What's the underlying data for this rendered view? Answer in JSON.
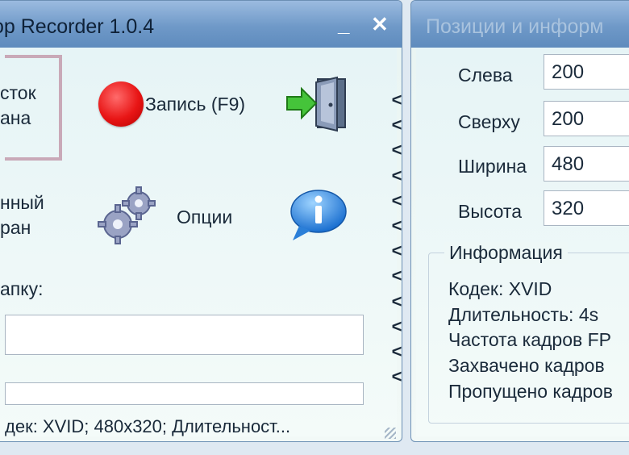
{
  "left_window": {
    "title": "op Recorder 1.0.4",
    "minimize_glyph": "_",
    "close_glyph": "✕",
    "region_button": {
      "line1": "сток",
      "line2": "ана"
    },
    "record_button": {
      "label": "Запись (F9)"
    },
    "exit_button": {
      "icon": "exit-door-icon"
    },
    "fullscreen_button": {
      "line1": "нный",
      "line2": "ран"
    },
    "options_button": {
      "label": "Опции"
    },
    "info_button": {
      "icon": "info-icon"
    },
    "folder_label": "апку:",
    "folder_input_value": "",
    "second_input_value": "",
    "collapse_chevrons": [
      "<",
      "<",
      "<",
      "<",
      "<",
      "<",
      "<",
      "<",
      "<",
      "<",
      "<",
      "<"
    ],
    "status_text": "дек: XVID; 480x320; Длительност..."
  },
  "right_window": {
    "title": "Позиции и информ",
    "fields": {
      "left": {
        "label": "Слева",
        "value": "200"
      },
      "top": {
        "label": "Сверху",
        "value": "200"
      },
      "width": {
        "label": "Ширина",
        "value": "480"
      },
      "height": {
        "label": "Высота",
        "value": "320"
      }
    },
    "info_group": {
      "title": "Информация",
      "codec": "Кодек: XVID",
      "duration": "Длительность: 4s",
      "fps": "Частота кадров FP",
      "captured": "Захвачено кадров",
      "dropped": "Пропущено кадров"
    }
  },
  "colors": {
    "title_bar": "#6f99c8",
    "client_bg": "#eaf5f3",
    "record_red": "#e81515",
    "selection_frame": "#c9a9b8"
  }
}
